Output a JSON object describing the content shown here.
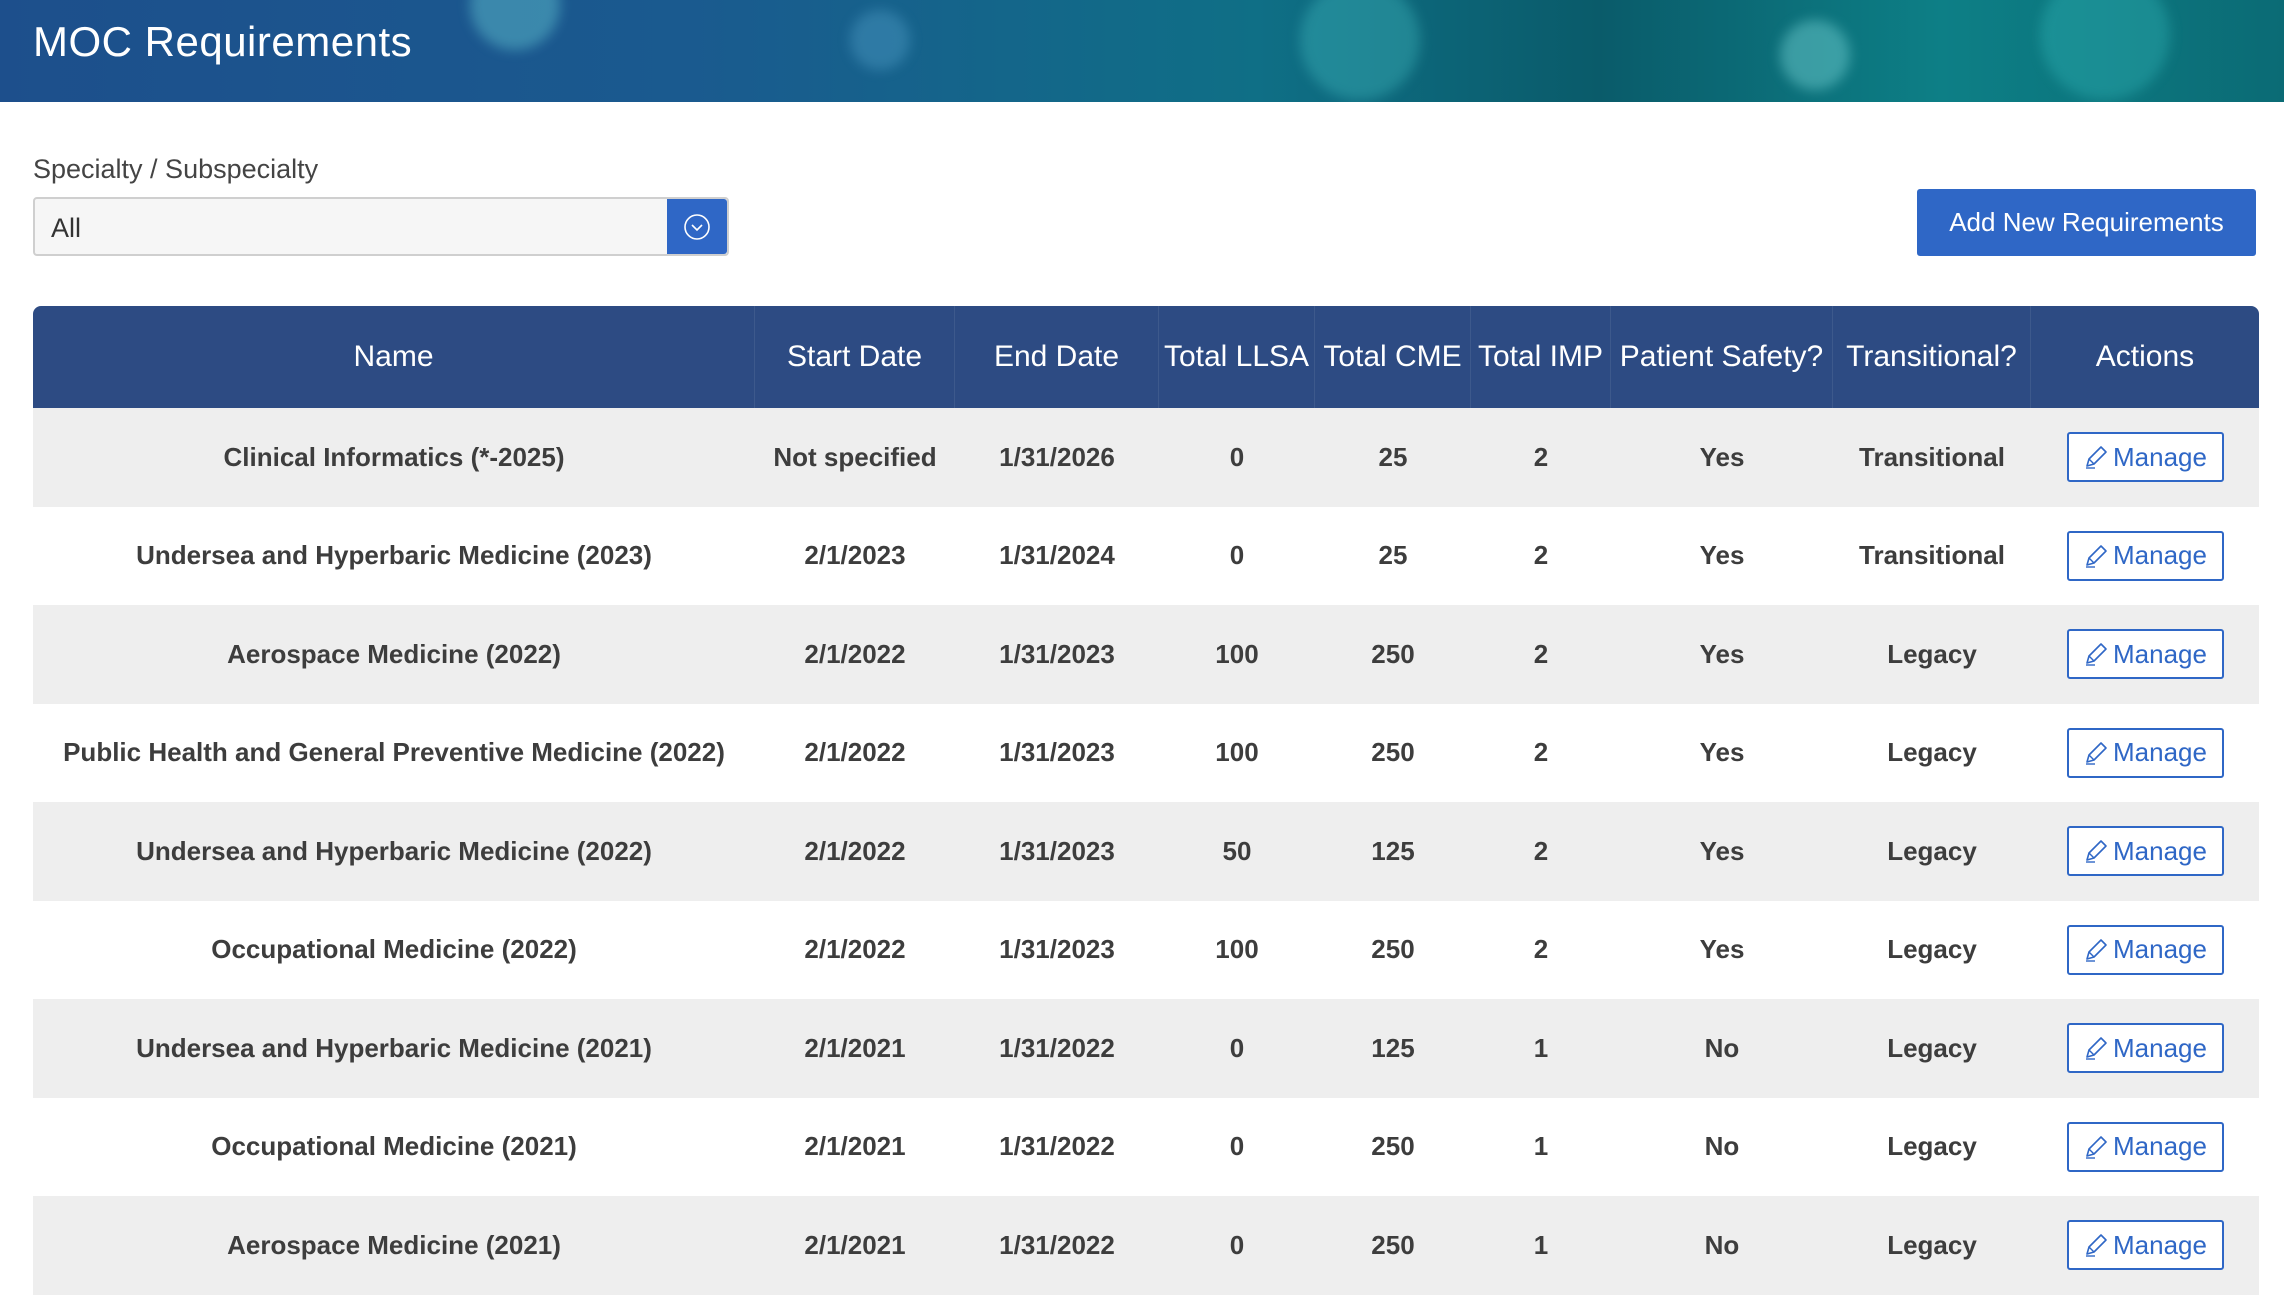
{
  "header": {
    "title": "MOC Requirements"
  },
  "filter": {
    "label": "Specialty / Subspecialty",
    "selected": "All",
    "dropdown_icon": "chevron-circle-down-icon"
  },
  "actions": {
    "add_label": "Add New Requirements"
  },
  "table": {
    "columns": [
      "Name",
      "Start Date",
      "End Date",
      "Total LLSA",
      "Total CME",
      "Total IMP",
      "Patient Safety?",
      "Transitional?",
      "Actions"
    ],
    "manage_label": "Manage",
    "manage_icon": "pencil-icon",
    "rows": [
      [
        "Clinical Informatics (*-2025)",
        "Not specified",
        "1/31/2026",
        "0",
        "25",
        "2",
        "Yes",
        "Transitional"
      ],
      [
        "Undersea and Hyperbaric Medicine (2023)",
        "2/1/2023",
        "1/31/2024",
        "0",
        "25",
        "2",
        "Yes",
        "Transitional"
      ],
      [
        "Aerospace Medicine (2022)",
        "2/1/2022",
        "1/31/2023",
        "100",
        "250",
        "2",
        "Yes",
        "Legacy"
      ],
      [
        "Public Health and General Preventive Medicine (2022)",
        "2/1/2022",
        "1/31/2023",
        "100",
        "250",
        "2",
        "Yes",
        "Legacy"
      ],
      [
        "Undersea and Hyperbaric Medicine (2022)",
        "2/1/2022",
        "1/31/2023",
        "50",
        "125",
        "2",
        "Yes",
        "Legacy"
      ],
      [
        "Occupational Medicine (2022)",
        "2/1/2022",
        "1/31/2023",
        "100",
        "250",
        "2",
        "Yes",
        "Legacy"
      ],
      [
        "Undersea and Hyperbaric Medicine (2021)",
        "2/1/2021",
        "1/31/2022",
        "0",
        "125",
        "1",
        "No",
        "Legacy"
      ],
      [
        "Occupational Medicine (2021)",
        "2/1/2021",
        "1/31/2022",
        "0",
        "250",
        "1",
        "No",
        "Legacy"
      ],
      [
        "Aerospace Medicine (2021)",
        "2/1/2021",
        "1/31/2022",
        "0",
        "250",
        "1",
        "No",
        "Legacy"
      ]
    ]
  },
  "colors": {
    "banner_start": "#1d4f8c",
    "banner_end": "#0b6b75",
    "primary": "#2f67c6",
    "table_header": "#2d4b83",
    "row_alt": "#eeeeee"
  }
}
